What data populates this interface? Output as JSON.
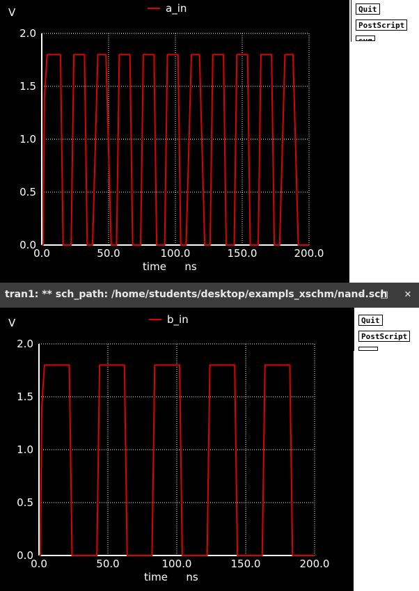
{
  "window2_title": "tran1: ** sch_path: /home/students/desktop/exampls_xschm/nand.sch",
  "window_controls": {
    "minimize": "–",
    "maximize": "□",
    "close": "✕"
  },
  "buttons": {
    "quit": "Quit",
    "postscript": "PostScript",
    "svg": "svg"
  },
  "colors": {
    "background": "#000000",
    "trace": "#e00000",
    "axis": "#ffffff",
    "grid": "#ffffff"
  },
  "chart_data": [
    {
      "type": "line",
      "ylabel": "V",
      "xlabel": "time",
      "xunit": "ns",
      "xlim": [
        0,
        200
      ],
      "ylim": [
        0,
        2
      ],
      "xticks": [
        "0.0",
        "50.0",
        "100.0",
        "150.0",
        "200.0"
      ],
      "yticks": [
        "0.0",
        "0.5",
        "1.0",
        "1.5",
        "2.0"
      ],
      "grid": true,
      "legend": "top-center",
      "series": [
        {
          "name": "a_in",
          "x": [
            0,
            1,
            2,
            4,
            6,
            12,
            14,
            16,
            18,
            22,
            24,
            26,
            28,
            32,
            34,
            36,
            38,
            42,
            44,
            46,
            48,
            52,
            54,
            56,
            58,
            62,
            64,
            66,
            68,
            72,
            74,
            76,
            78,
            82,
            84,
            86,
            88,
            92,
            94,
            96,
            98,
            102,
            104,
            106,
            108,
            112,
            114,
            116,
            118,
            122,
            124,
            126,
            128,
            132,
            134,
            136,
            138,
            142,
            144,
            146,
            148,
            152,
            154,
            156,
            158,
            162,
            164,
            166,
            168,
            172,
            174,
            176,
            178,
            182,
            184,
            186,
            188,
            192,
            194,
            196,
            198,
            200
          ],
          "y": [
            0,
            0,
            1.4,
            1.8,
            1.8,
            1.8,
            1.8,
            0,
            0,
            0,
            1.8,
            1.8,
            1.8,
            1.8,
            0,
            0,
            0,
            1.8,
            1.8,
            1.8,
            1.8,
            0,
            0,
            0,
            1.8,
            1.8,
            1.8,
            1.8,
            0,
            0,
            0,
            1.8,
            1.8,
            1.8,
            1.8,
            0,
            0,
            0,
            1.8,
            1.8,
            1.8,
            1.8,
            0,
            0,
            0,
            1.8,
            1.8,
            1.8,
            1.8,
            0,
            0,
            0,
            1.8,
            1.8,
            1.8,
            1.8,
            0,
            0,
            0,
            1.8,
            1.8,
            1.8,
            1.8,
            0,
            0,
            0,
            1.8,
            1.8,
            1.8,
            1.8,
            0,
            0,
            0,
            1.8,
            1.8,
            1.8,
            1.8,
            0,
            0,
            0,
            0,
            0
          ]
        }
      ]
    },
    {
      "type": "line",
      "ylabel": "V",
      "xlabel": "time",
      "xunit": "ns",
      "xlim": [
        0,
        200
      ],
      "ylim": [
        0,
        2
      ],
      "xticks": [
        "0.0",
        "50.0",
        "100.0",
        "150.0",
        "200.0"
      ],
      "yticks": [
        "0.0",
        "0.5",
        "1.0",
        "1.5",
        "2.0"
      ],
      "grid": true,
      "legend": "top-center",
      "series": [
        {
          "name": "b_in",
          "x": [
            0,
            1,
            2,
            4,
            6,
            22,
            24,
            42,
            44,
            62,
            64,
            82,
            84,
            102,
            104,
            122,
            124,
            142,
            144,
            162,
            164,
            182,
            184,
            200
          ],
          "y": [
            0,
            0,
            1.4,
            1.8,
            1.8,
            1.8,
            0,
            0,
            1.8,
            1.8,
            0,
            0,
            1.8,
            1.8,
            0,
            0,
            1.8,
            1.8,
            0,
            0,
            1.8,
            1.8,
            0,
            0
          ]
        }
      ]
    }
  ]
}
